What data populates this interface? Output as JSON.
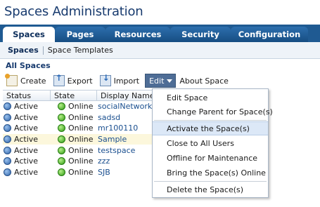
{
  "app": {
    "title": "Spaces Administration"
  },
  "tabs": [
    "Spaces",
    "Pages",
    "Resources",
    "Security",
    "Configuration"
  ],
  "subtabs": {
    "active": "Spaces",
    "other": "Space Templates"
  },
  "section": {
    "title": "All Spaces"
  },
  "toolbar": {
    "create": "Create",
    "export": "Export",
    "import": "Import",
    "edit": "Edit",
    "about": "About Space"
  },
  "grid": {
    "headers": [
      "Status",
      "State",
      "Display Name"
    ],
    "rows": [
      {
        "status": "Active",
        "state": "Online",
        "name": "socialNetworkin"
      },
      {
        "status": "Active",
        "state": "Online",
        "name": "sadsd"
      },
      {
        "status": "Active",
        "state": "Online",
        "name": "mr100110"
      },
      {
        "status": "Active",
        "state": "Online",
        "name": "Sample"
      },
      {
        "status": "Active",
        "state": "Online",
        "name": "testspace"
      },
      {
        "status": "Active",
        "state": "Online",
        "name": "zzz"
      },
      {
        "status": "Active",
        "state": "Online",
        "name": "SJB"
      }
    ]
  },
  "edit_menu": [
    "Edit Space",
    "Change Parent for Space(s)",
    "Activate the Space(s)",
    "Close to All Users",
    "Offline for Maintenance",
    "Bring the Space(s) Online",
    "Delete the Space(s)"
  ]
}
